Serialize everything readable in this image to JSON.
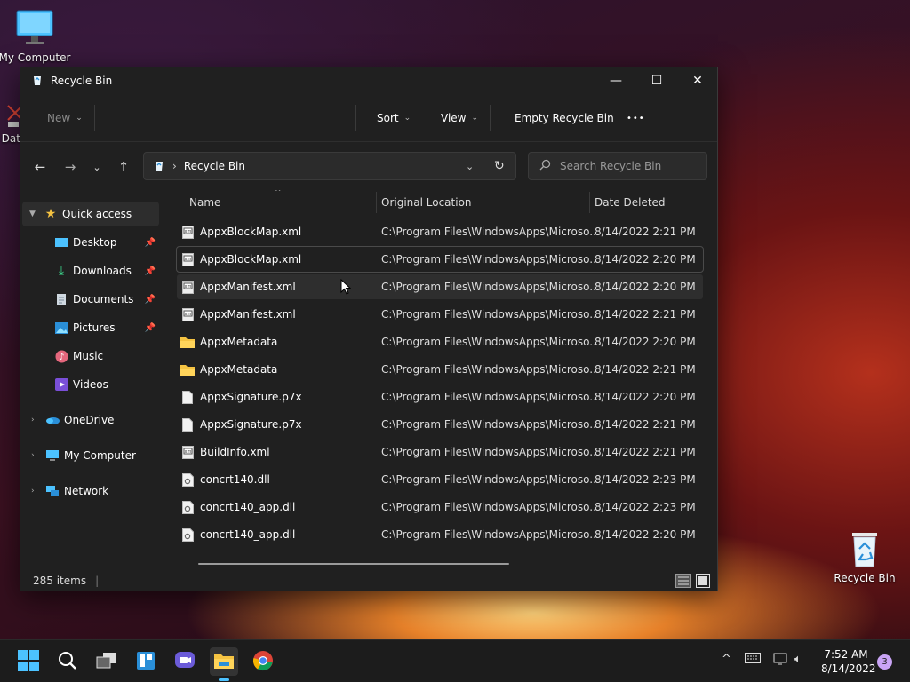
{
  "desktop": {
    "icons": [
      {
        "label": "My Computer"
      },
      {
        "label": "Data"
      },
      {
        "label": "Recycle Bin"
      }
    ]
  },
  "window": {
    "title": "Recycle Bin",
    "controls": {
      "minimize": "—",
      "maximize": "☐",
      "close": "✕"
    },
    "toolbar": {
      "new_label": "New",
      "sort_label": "Sort",
      "view_label": "View",
      "empty_label": "Empty Recycle Bin",
      "more_label": "•••"
    },
    "address": {
      "path": "Recycle Bin"
    },
    "search": {
      "placeholder": "Search Recycle Bin"
    },
    "nav": {
      "quick_access": "Quick access",
      "items": [
        {
          "label": "Desktop",
          "pinned": true
        },
        {
          "label": "Downloads",
          "pinned": true
        },
        {
          "label": "Documents",
          "pinned": true
        },
        {
          "label": "Pictures",
          "pinned": true
        },
        {
          "label": "Music",
          "pinned": false
        },
        {
          "label": "Videos",
          "pinned": false
        }
      ],
      "onedrive": "OneDrive",
      "my_computer": "My Computer",
      "network": "Network"
    },
    "columns": {
      "name": "Name",
      "location": "Original Location",
      "date": "Date Deleted"
    },
    "files": [
      {
        "name": "AppxBlockMap.xml",
        "type": "xml",
        "location": "C:\\Program Files\\WindowsApps\\Microso...",
        "date": "8/14/2022 2:21 PM"
      },
      {
        "name": "AppxBlockMap.xml",
        "type": "xml",
        "location": "C:\\Program Files\\WindowsApps\\Microso...",
        "date": "8/14/2022 2:20 PM"
      },
      {
        "name": "AppxManifest.xml",
        "type": "xml",
        "location": "C:\\Program Files\\WindowsApps\\Microso...",
        "date": "8/14/2022 2:20 PM"
      },
      {
        "name": "AppxManifest.xml",
        "type": "xml",
        "location": "C:\\Program Files\\WindowsApps\\Microso...",
        "date": "8/14/2022 2:21 PM"
      },
      {
        "name": "AppxMetadata",
        "type": "folder",
        "location": "C:\\Program Files\\WindowsApps\\Microso...",
        "date": "8/14/2022 2:20 PM"
      },
      {
        "name": "AppxMetadata",
        "type": "folder",
        "location": "C:\\Program Files\\WindowsApps\\Microso...",
        "date": "8/14/2022 2:21 PM"
      },
      {
        "name": "AppxSignature.p7x",
        "type": "file",
        "location": "C:\\Program Files\\WindowsApps\\Microso...",
        "date": "8/14/2022 2:20 PM"
      },
      {
        "name": "AppxSignature.p7x",
        "type": "file",
        "location": "C:\\Program Files\\WindowsApps\\Microso...",
        "date": "8/14/2022 2:21 PM"
      },
      {
        "name": "BuildInfo.xml",
        "type": "xml",
        "location": "C:\\Program Files\\WindowsApps\\Microso...",
        "date": "8/14/2022 2:21 PM"
      },
      {
        "name": "concrt140.dll",
        "type": "dll",
        "location": "C:\\Program Files\\WindowsApps\\Microso...",
        "date": "8/14/2022 2:23 PM"
      },
      {
        "name": "concrt140_app.dll",
        "type": "dll",
        "location": "C:\\Program Files\\WindowsApps\\Microso...",
        "date": "8/14/2022 2:23 PM"
      },
      {
        "name": "concrt140_app.dll",
        "type": "dll",
        "location": "C:\\Program Files\\WindowsApps\\Microso...",
        "date": "8/14/2022 2:20 PM"
      }
    ],
    "status": {
      "count": "285 items"
    }
  },
  "taskbar": {
    "time": "7:52 AM",
    "date": "8/14/2022",
    "notifications": "3"
  },
  "colors": {
    "accent": "#4cc2ff",
    "folder": "#f5c342",
    "window_bg": "#202020"
  }
}
